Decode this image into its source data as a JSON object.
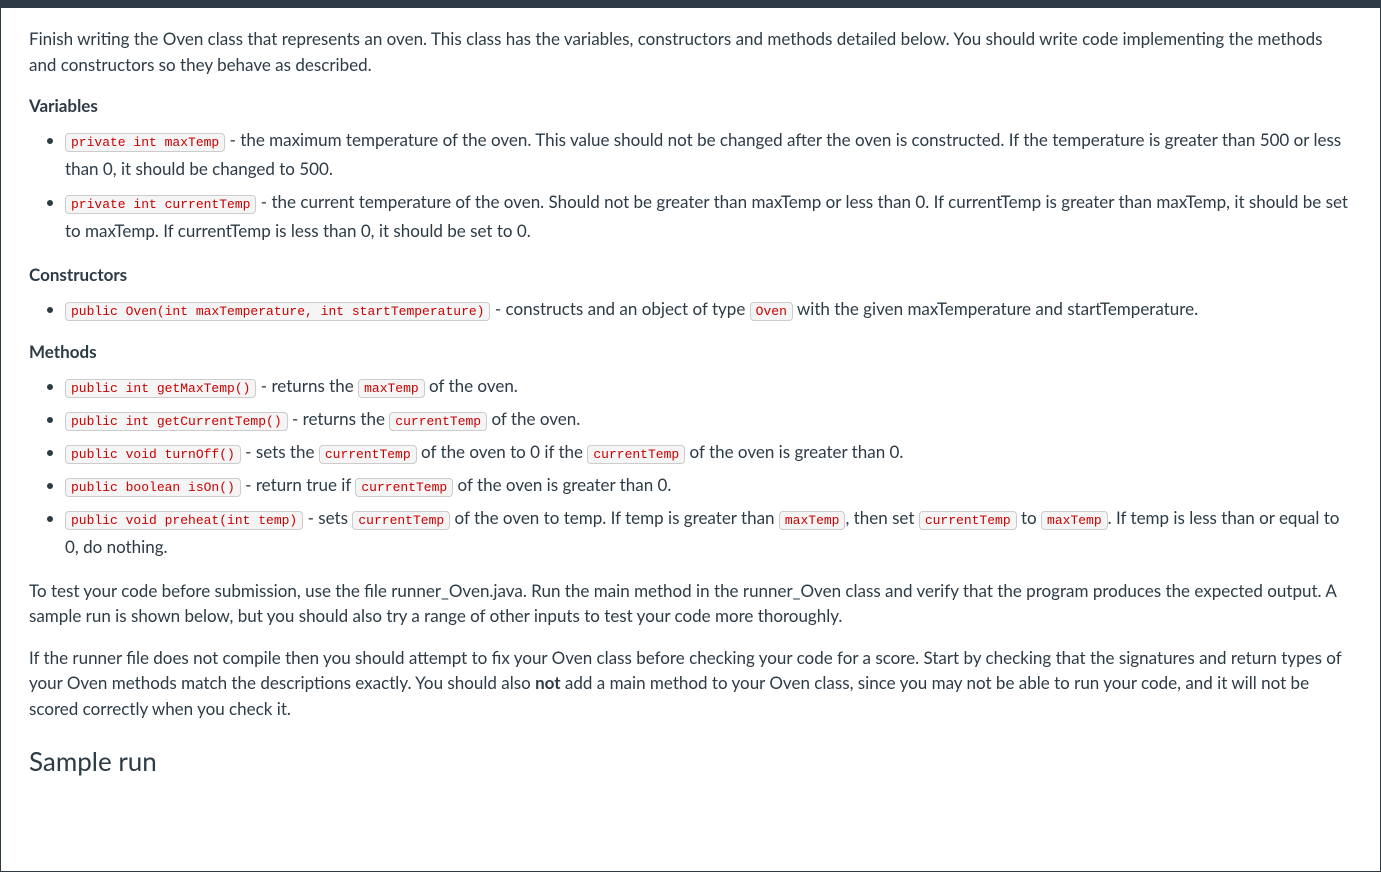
{
  "intro": "Finish writing the Oven class that represents an oven. This class has the variables, constructors and methods detailed below. You should write code implementing the methods and constructors so they behave as described.",
  "sections": {
    "variables": {
      "heading": "Variables",
      "items": [
        {
          "code": "private int maxTemp",
          "desc": " - the maximum temperature of the oven. This value should not be changed after the oven is constructed. If the temperature is greater than 500 or less than 0, it should be changed to 500."
        },
        {
          "code": "private int currentTemp",
          "desc": " - the current temperature of the oven. Should not be greater than maxTemp or less than 0. If currentTemp is greater than maxTemp, it should be set to maxTemp. If currentTemp is less than 0, it should be set to 0."
        }
      ]
    },
    "constructors": {
      "heading": "Constructors",
      "items": [
        {
          "code": "public Oven(int maxTemperature, int startTemperature)",
          "desc_pre": " - constructs and an object of type ",
          "inline_code": "Oven",
          "desc_post": " with the given maxTemperature and startTemperature."
        }
      ]
    },
    "methods": {
      "heading": "Methods",
      "items": [
        {
          "segments": [
            {
              "t": "code",
              "v": "public int getMaxTemp()"
            },
            {
              "t": "text",
              "v": " - returns the "
            },
            {
              "t": "code",
              "v": "maxTemp"
            },
            {
              "t": "text",
              "v": " of the oven."
            }
          ]
        },
        {
          "segments": [
            {
              "t": "code",
              "v": "public int getCurrentTemp()"
            },
            {
              "t": "text",
              "v": " - returns the "
            },
            {
              "t": "code",
              "v": "currentTemp"
            },
            {
              "t": "text",
              "v": " of the oven."
            }
          ]
        },
        {
          "segments": [
            {
              "t": "code",
              "v": "public void turnOff()"
            },
            {
              "t": "text",
              "v": " - sets the "
            },
            {
              "t": "code",
              "v": "currentTemp"
            },
            {
              "t": "text",
              "v": " of the oven to 0 if the "
            },
            {
              "t": "code",
              "v": "currentTemp"
            },
            {
              "t": "text",
              "v": " of the oven is greater than 0."
            }
          ]
        },
        {
          "segments": [
            {
              "t": "code",
              "v": "public boolean isOn()"
            },
            {
              "t": "text",
              "v": " - return true if "
            },
            {
              "t": "code",
              "v": "currentTemp"
            },
            {
              "t": "text",
              "v": " of the oven is greater than 0."
            }
          ]
        },
        {
          "segments": [
            {
              "t": "code",
              "v": "public void preheat(int temp)"
            },
            {
              "t": "text",
              "v": " - sets "
            },
            {
              "t": "code",
              "v": "currentTemp"
            },
            {
              "t": "text",
              "v": " of the oven to temp. If temp is greater than "
            },
            {
              "t": "code",
              "v": "maxTemp"
            },
            {
              "t": "text",
              "v": ", then set "
            },
            {
              "t": "code",
              "v": "currentTemp"
            },
            {
              "t": "text",
              "v": " to "
            },
            {
              "t": "code",
              "v": "maxTemp"
            },
            {
              "t": "text",
              "v": ". If temp is less than or equal to 0, do nothing."
            }
          ]
        }
      ]
    }
  },
  "testing_para": "To test your code before submission, use the file runner_Oven.java. Run the main method in the runner_Oven class and verify that the program produces the expected output. A sample run is shown below, but you should also try a range of other inputs to test your code more thoroughly.",
  "runner_para": {
    "pre": "If the runner file does not compile then you should attempt to fix your Oven class before checking your code for a score. Start by checking that the signatures and return types of your Oven methods match the descriptions exactly. You should also ",
    "bold": "not",
    "post": " add a main method to your Oven class, since you may not be able to run your code, and it will not be scored correctly when you check it."
  },
  "sample_heading": "Sample run"
}
